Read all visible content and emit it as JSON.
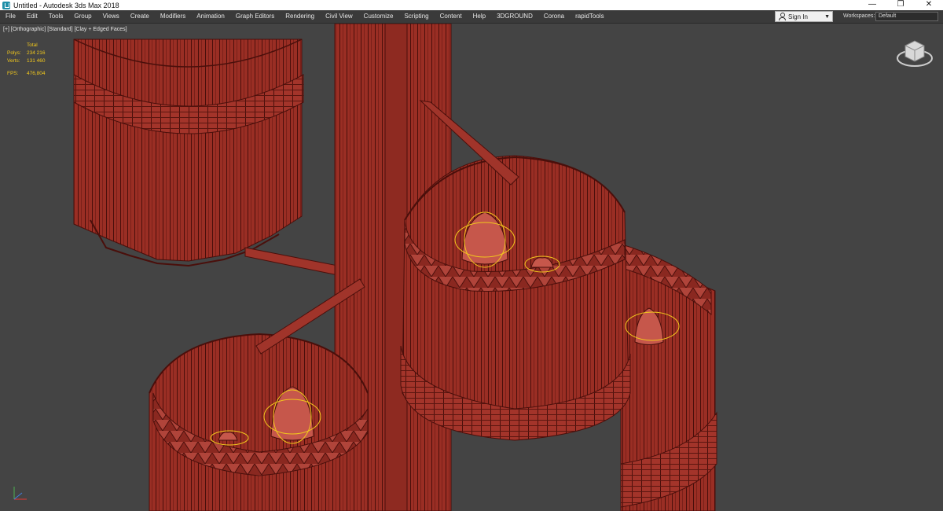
{
  "window": {
    "title": "Untitled - Autodesk 3ds Max 2018",
    "controls": {
      "minimize": "—",
      "restore": "❐",
      "close": "✕"
    }
  },
  "menu": {
    "items": [
      {
        "label": "File"
      },
      {
        "label": "Edit"
      },
      {
        "label": "Tools"
      },
      {
        "label": "Group"
      },
      {
        "label": "Views"
      },
      {
        "label": "Create"
      },
      {
        "label": "Modifiers"
      },
      {
        "label": "Animation"
      },
      {
        "label": "Graph Editors"
      },
      {
        "label": "Rendering"
      },
      {
        "label": "Civil View"
      },
      {
        "label": "Customize"
      },
      {
        "label": "Scripting"
      },
      {
        "label": "Content"
      },
      {
        "label": "Help"
      },
      {
        "label": "3DGROUND"
      },
      {
        "label": "Corona"
      },
      {
        "label": "rapidTools"
      }
    ],
    "signin_label": "Sign In",
    "workspaces_label": "Workspaces:",
    "workspaces_value": "Default"
  },
  "viewport": {
    "label": "[+] [Orthographic] [Standard] [Clay + Edged Faces]",
    "stats": {
      "header": "Total",
      "polys_label": "Polys:",
      "polys_value": "234 216",
      "verts_label": "Verts:",
      "verts_value": "131 460",
      "fps_label": "FPS:",
      "fps_value": "476,804"
    }
  },
  "colors": {
    "viewport_bg": "#444444",
    "mesh_fill": "#9a2e24",
    "mesh_edge": "#4a0f0b",
    "selection_gizmo": "#f2c81c",
    "stats_text": "#f2c81c"
  }
}
